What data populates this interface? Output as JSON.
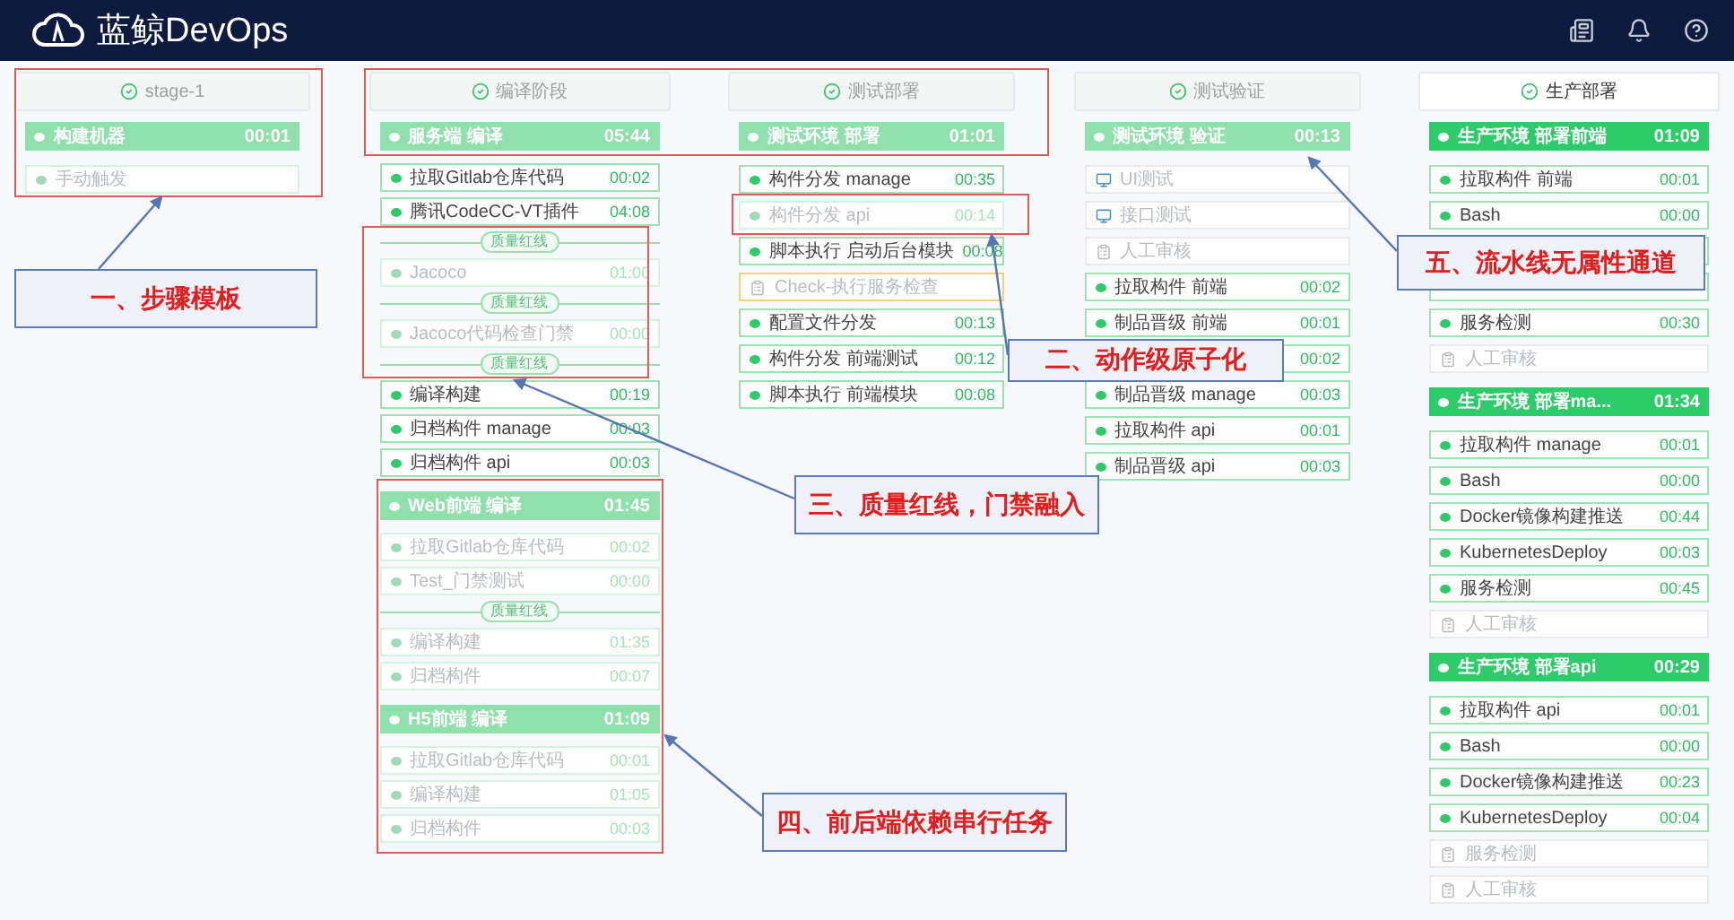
{
  "app": {
    "title": "蓝鲸DevOps"
  },
  "stages": [
    {
      "name": "stage-1",
      "faded": true,
      "jobs": [
        {
          "name": "构建机器",
          "time": "00:01",
          "rows": [
            {
              "kind": "step",
              "label": "手动触发",
              "faded": true
            }
          ]
        }
      ]
    },
    {
      "name": "编译阶段",
      "faded": true,
      "jobs": [
        {
          "name": "服务端 编译",
          "time": "05:44",
          "rows": [
            {
              "kind": "step",
              "label": "拉取Gitlab仓库代码",
              "time": "00:02",
              "faded": false
            },
            {
              "kind": "step",
              "label": "腾讯CodeCC-VT插件",
              "time": "04:08",
              "faded": false
            },
            {
              "kind": "gate",
              "label": "质量红线"
            },
            {
              "kind": "step",
              "label": "Jacoco",
              "time": "01:00",
              "faded": true
            },
            {
              "kind": "gate",
              "label": "质量红线"
            },
            {
              "kind": "step",
              "label": "Jacoco代码检查门禁",
              "time": "00:00",
              "faded": true
            },
            {
              "kind": "gate",
              "label": "质量红线"
            },
            {
              "kind": "step",
              "label": "编译构建",
              "time": "00:19",
              "faded": false
            },
            {
              "kind": "step",
              "label": "归档构件 manage",
              "time": "00:03",
              "faded": false
            },
            {
              "kind": "step",
              "label": "归档构件 api",
              "time": "00:03",
              "faded": false
            }
          ]
        },
        {
          "name": "Web前端 编译",
          "time": "01:45",
          "rows": [
            {
              "kind": "step",
              "label": "拉取Gitlab仓库代码",
              "time": "00:02",
              "faded": true
            },
            {
              "kind": "step",
              "label": "Test_门禁测试",
              "time": "00:00",
              "faded": true
            },
            {
              "kind": "gate",
              "label": "质量红线"
            },
            {
              "kind": "step",
              "label": "编译构建",
              "time": "01:35",
              "faded": true
            },
            {
              "kind": "step",
              "label": "归档构件",
              "time": "00:07",
              "faded": true
            }
          ]
        },
        {
          "name": "H5前端 编译",
          "time": "01:09",
          "rows": [
            {
              "kind": "step",
              "label": "拉取Gitlab仓库代码",
              "time": "00:01",
              "faded": true
            },
            {
              "kind": "step",
              "label": "编译构建",
              "time": "01:05",
              "faded": true
            },
            {
              "kind": "step",
              "label": "归档构件",
              "time": "00:03",
              "faded": true
            }
          ]
        }
      ]
    },
    {
      "name": "测试部署",
      "faded": true,
      "jobs": [
        {
          "name": "测试环境 部署",
          "time": "01:01",
          "rows": [
            {
              "kind": "step",
              "label": "构件分发 manage",
              "time": "00:35",
              "faded": false
            },
            {
              "kind": "step",
              "label": "构件分发 api",
              "time": "00:14",
              "faded": true
            },
            {
              "kind": "step",
              "label": "脚本执行 启动后台模块",
              "time": "00:08",
              "faded": false
            },
            {
              "kind": "check",
              "label": "Check-执行服务检查"
            },
            {
              "kind": "step",
              "label": "配置文件分发",
              "time": "00:13",
              "faded": false
            },
            {
              "kind": "step",
              "label": "构件分发 前端测试",
              "time": "00:12",
              "faded": false
            },
            {
              "kind": "step",
              "label": "脚本执行 前端模块",
              "time": "00:08",
              "faded": false
            }
          ]
        }
      ]
    },
    {
      "name": "测试验证",
      "faded": true,
      "jobs": [
        {
          "name": "测试环境 验证",
          "time": "00:13",
          "rows": [
            {
              "kind": "test",
              "label": "UI测试"
            },
            {
              "kind": "test",
              "label": "接口测试"
            },
            {
              "kind": "manual",
              "label": "人工审核"
            },
            {
              "kind": "step",
              "label": "拉取构件 前端",
              "time": "00:02",
              "faded": false
            },
            {
              "kind": "step",
              "label": "制品晋级 前端",
              "time": "00:01",
              "faded": false
            },
            {
              "kind": "covered",
              "time": "00:02"
            },
            {
              "kind": "step",
              "label": "制品晋级 manage",
              "time": "00:03",
              "faded": false
            },
            {
              "kind": "step",
              "label": "拉取构件 api",
              "time": "00:01",
              "faded": false
            },
            {
              "kind": "step",
              "label": "制品晋级 api",
              "time": "00:03",
              "faded": false
            }
          ]
        }
      ]
    },
    {
      "name": "生产部署",
      "faded": false,
      "jobs": [
        {
          "name": "生产环境 部署前端",
          "time": "01:09",
          "rows": [
            {
              "kind": "step",
              "label": "拉取构件 前端",
              "time": "00:01",
              "faded": false
            },
            {
              "kind": "step",
              "label": "Bash",
              "time": "00:00",
              "faded": false
            },
            {
              "kind": "covered"
            },
            {
              "kind": "covered"
            },
            {
              "kind": "step",
              "label": "服务检测",
              "time": "00:30",
              "faded": false
            },
            {
              "kind": "manual",
              "label": "人工审核"
            }
          ]
        },
        {
          "name": "生产环境 部署ma...",
          "time": "01:34",
          "rows": [
            {
              "kind": "step",
              "label": "拉取构件 manage",
              "time": "00:01",
              "faded": false
            },
            {
              "kind": "step",
              "label": "Bash",
              "time": "00:00",
              "faded": false
            },
            {
              "kind": "step",
              "label": "Docker镜像构建推送",
              "time": "00:44",
              "faded": false
            },
            {
              "kind": "step",
              "label": "KubernetesDeploy",
              "time": "00:03",
              "faded": false
            },
            {
              "kind": "step",
              "label": "服务检测",
              "time": "00:45",
              "faded": false
            },
            {
              "kind": "manual",
              "label": "人工审核"
            }
          ]
        },
        {
          "name": "生产环境 部署api",
          "time": "00:29",
          "rows": [
            {
              "kind": "step",
              "label": "拉取构件 api",
              "time": "00:01",
              "faded": false
            },
            {
              "kind": "step",
              "label": "Bash",
              "time": "00:00",
              "faded": false
            },
            {
              "kind": "step",
              "label": "Docker镜像构建推送",
              "time": "00:23",
              "faded": false
            },
            {
              "kind": "step",
              "label": "KubernetesDeploy",
              "time": "00:04",
              "faded": false
            },
            {
              "kind": "manual",
              "label": "服务检测"
            },
            {
              "kind": "manual",
              "label": "人工审核"
            }
          ]
        }
      ]
    }
  ],
  "annotations": [
    {
      "text": "一、步骤模板"
    },
    {
      "text": "二、动作级原子化"
    },
    {
      "text": "三、质量红线，门禁融入"
    },
    {
      "text": "四、前后端依赖串行任务"
    },
    {
      "text": "五、流水线无属性通道"
    }
  ]
}
